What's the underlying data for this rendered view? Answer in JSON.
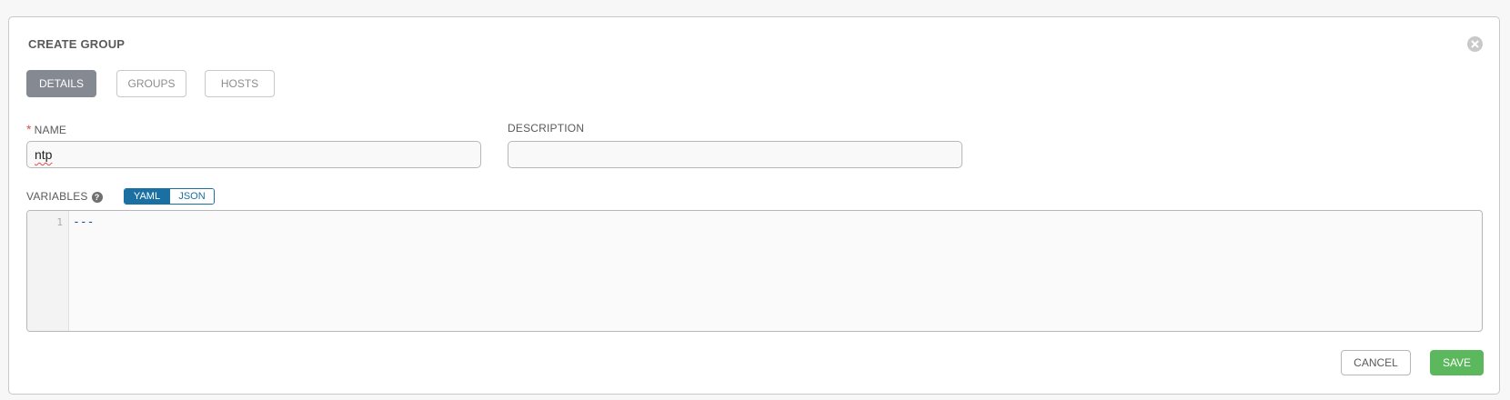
{
  "panel": {
    "title": "CREATE GROUP"
  },
  "tabs": [
    {
      "label": "DETAILS",
      "active": true
    },
    {
      "label": "GROUPS",
      "active": false
    },
    {
      "label": "HOSTS",
      "active": false
    }
  ],
  "form": {
    "name": {
      "required_mark": "*",
      "label": "NAME",
      "value": "ntp",
      "spellcheck_error": true
    },
    "description": {
      "label": "DESCRIPTION",
      "value": ""
    },
    "variables": {
      "label": "VARIABLES",
      "help_icon": "question-circle-icon",
      "help_glyph": "?",
      "format_options": [
        "YAML",
        "JSON"
      ],
      "selected_format": "YAML",
      "lines": [
        {
          "number": "1",
          "text": "---"
        }
      ]
    }
  },
  "actions": {
    "cancel_label": "CANCEL",
    "save_label": "SAVE"
  },
  "icons": {
    "close": "close-circle-icon"
  },
  "colors": {
    "active_tab": "#848992",
    "toggle_accent": "#1a6fa3",
    "save": "#5cb85c",
    "required": "#d9534f"
  }
}
